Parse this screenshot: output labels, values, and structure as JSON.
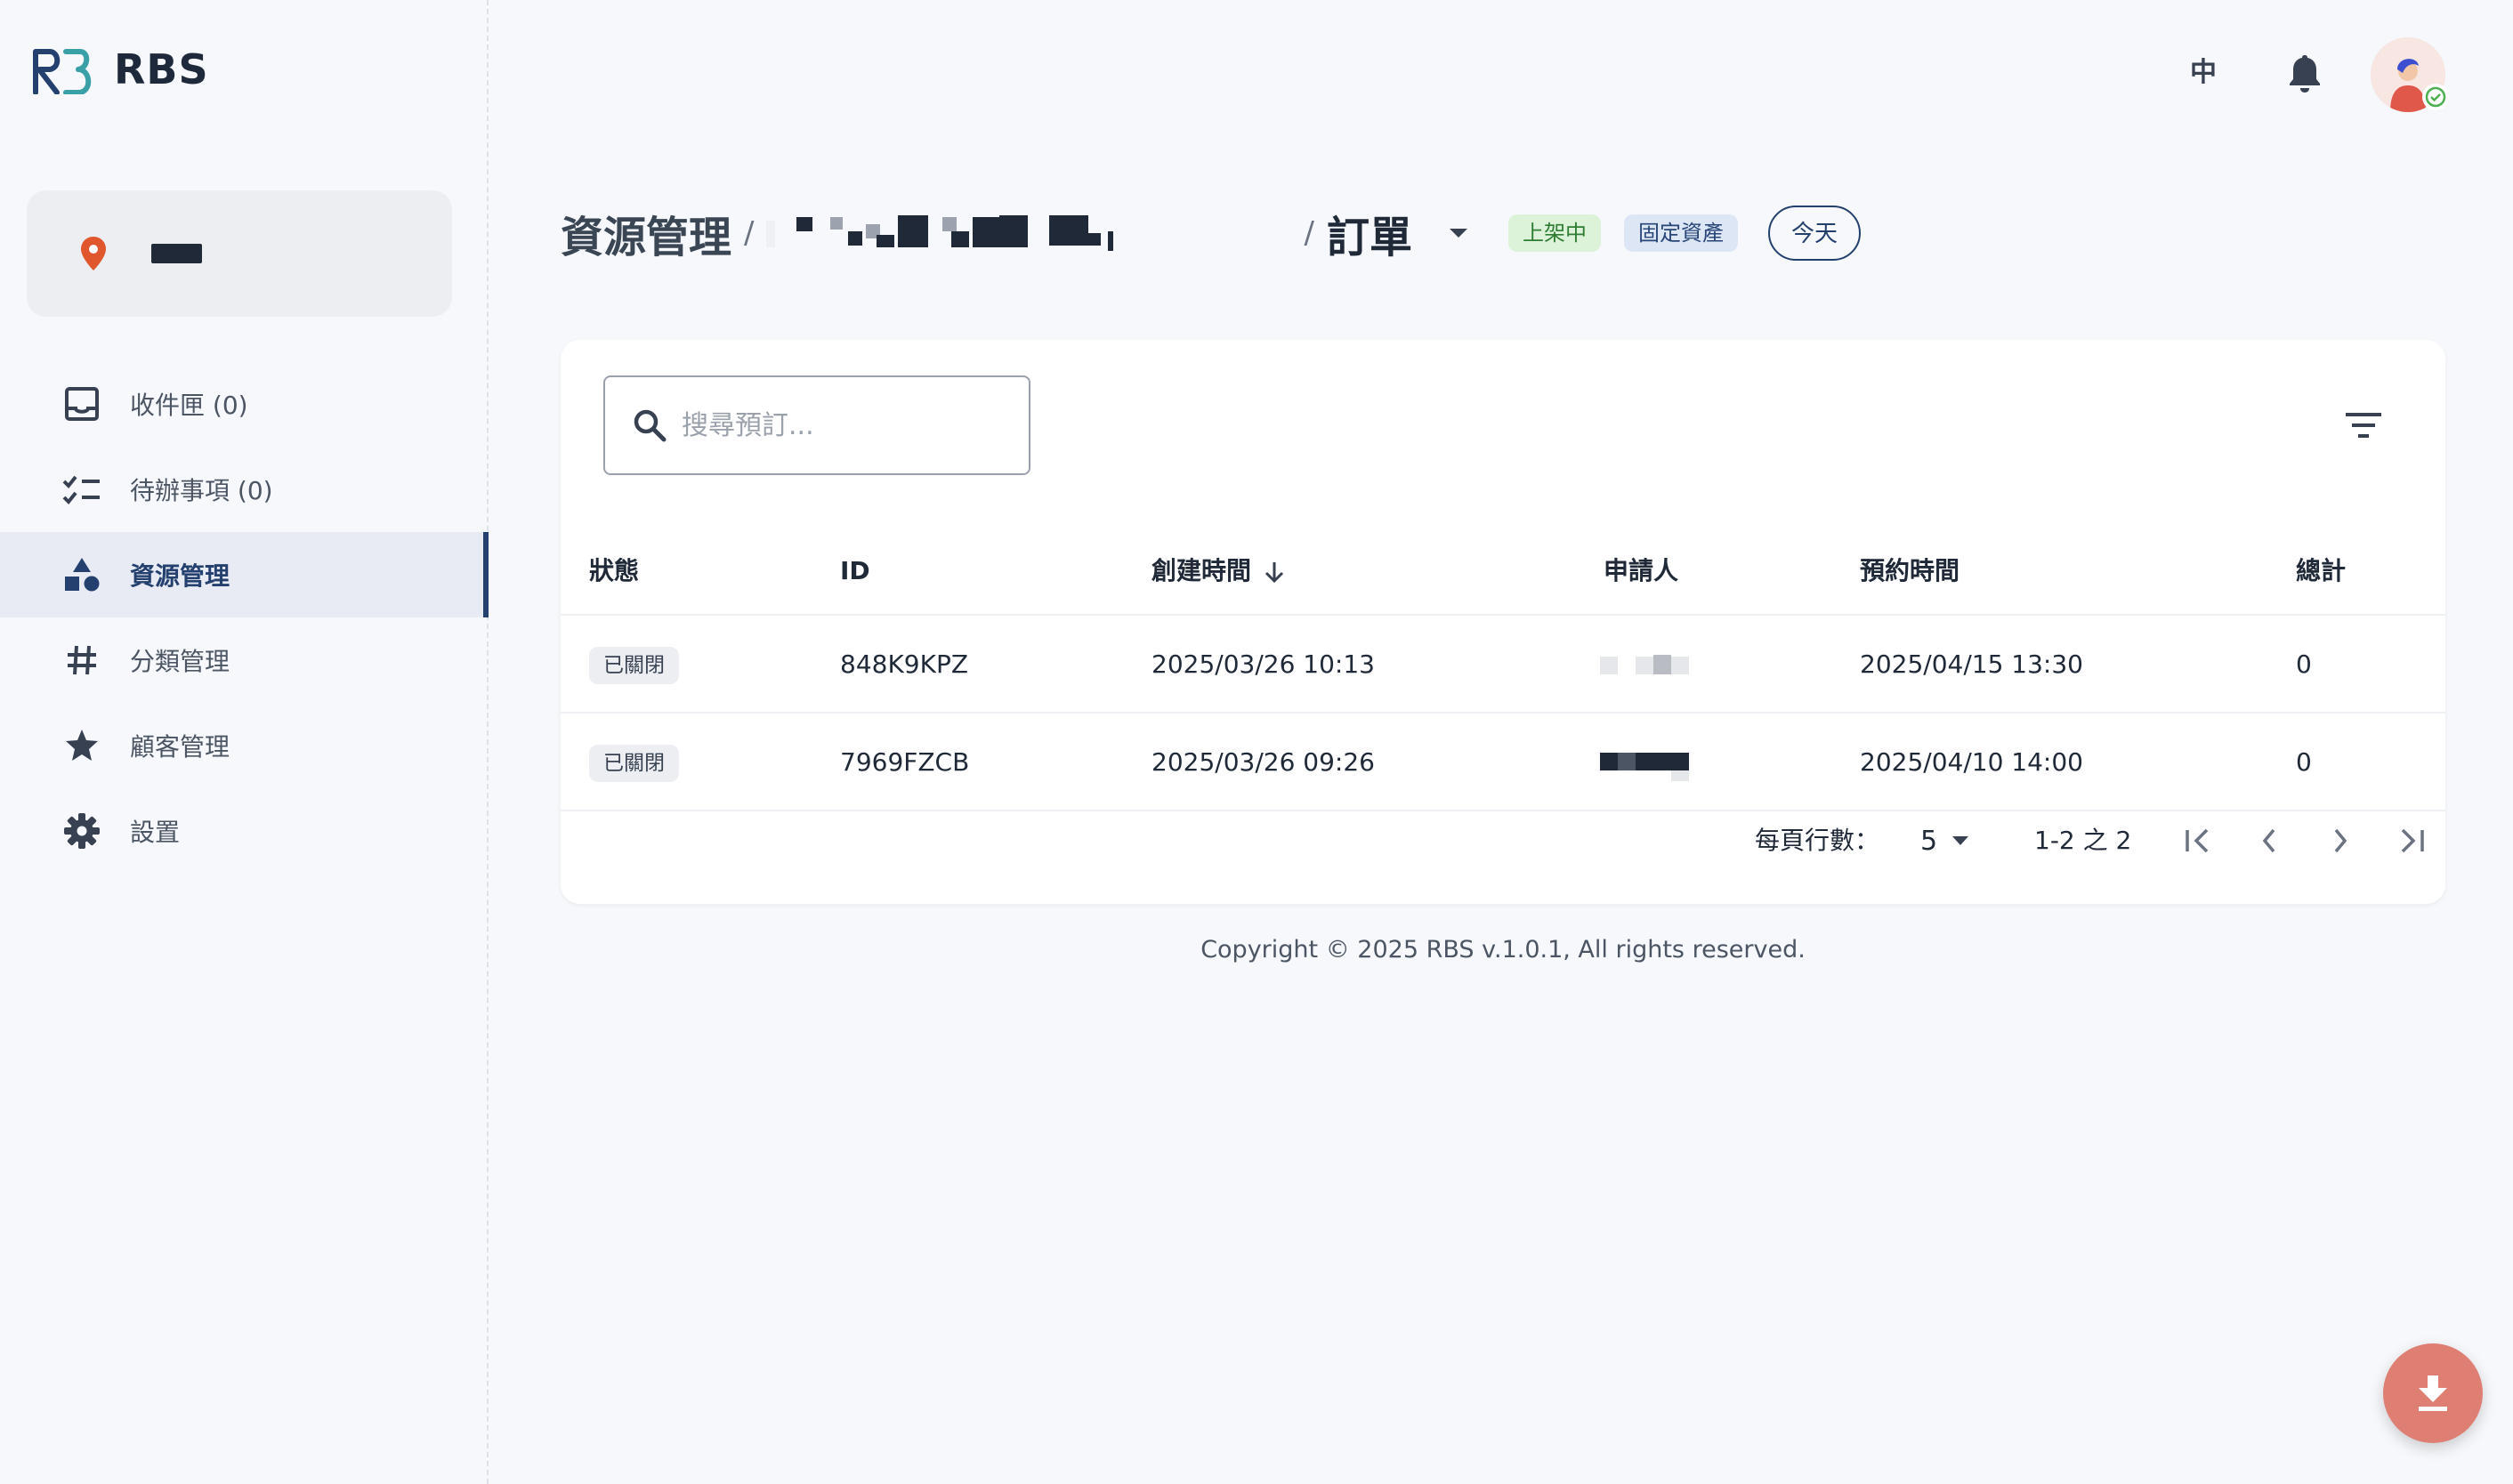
{
  "brand": {
    "name": "RBS"
  },
  "location": {
    "name": "■■"
  },
  "sidebar": {
    "items": [
      {
        "label": "收件匣 (0)",
        "icon": "inbox-icon",
        "active": false
      },
      {
        "label": "待辦事項 (0)",
        "icon": "checklist-icon",
        "active": false
      },
      {
        "label": "資源管理",
        "icon": "shapes-icon",
        "active": true
      },
      {
        "label": "分類管理",
        "icon": "hashtag-icon",
        "active": false
      },
      {
        "label": "顧客管理",
        "icon": "star-icon",
        "active": false
      },
      {
        "label": "設置",
        "icon": "gear-icon",
        "active": false
      }
    ]
  },
  "topbar": {
    "language": "中",
    "notifications_icon": "bell-icon",
    "avatar_icon": "avatar-icon"
  },
  "header": {
    "breadcrumb_root": "資源管理",
    "separator": "/",
    "breadcrumb_page": "訂單",
    "tags": [
      "上架中",
      "固定資產"
    ],
    "today_button": "今天"
  },
  "search": {
    "placeholder": "搜尋預訂...",
    "value": ""
  },
  "table": {
    "columns": [
      "狀態",
      "ID",
      "創建時間",
      "申請人",
      "預約時間",
      "總計"
    ],
    "sorted_column": "創建時間",
    "sort_direction": "descending",
    "rows": [
      {
        "status": "已關閉",
        "id": "848K9KPZ",
        "created": "2025/03/26 10:13",
        "applicant": "",
        "reserved": "2025/04/15 13:30",
        "total": "0"
      },
      {
        "status": "已關閉",
        "id": "7969FZCB",
        "created": "2025/03/26 09:26",
        "applicant": "",
        "reserved": "2025/04/10 14:00",
        "total": "0"
      }
    ]
  },
  "pagination": {
    "rows_per_page_label": "每頁行數：",
    "rows_per_page": "5",
    "range": "1-2 之 2"
  },
  "footer": {
    "copyright": "Copyright © 2025 RBS v.1.0.1, All rights reserved."
  },
  "colors": {
    "primary": "#24406f",
    "accent_fab": "#df7f74",
    "tag_green_bg": "#dcf3da",
    "tag_blue_bg": "#dde6f5",
    "background": "#f6f8fb"
  }
}
